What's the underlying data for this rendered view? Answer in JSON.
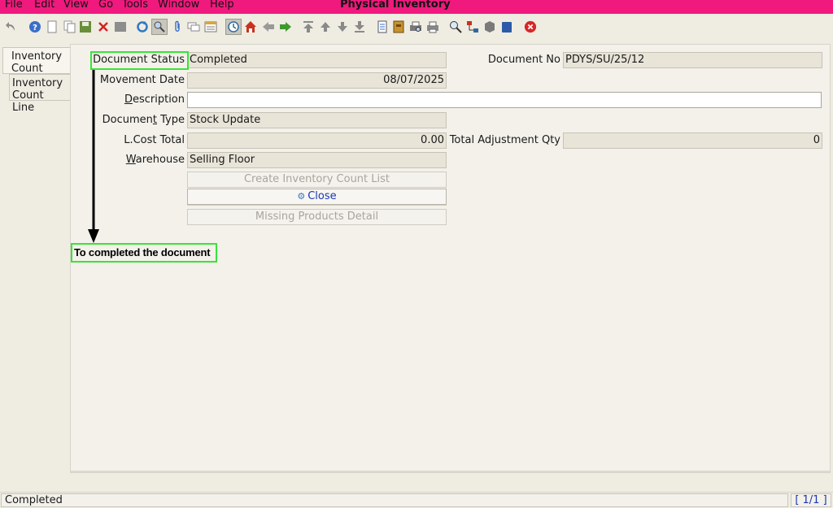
{
  "menu": {
    "file": "File",
    "edit": "Edit",
    "view": "View",
    "go": "Go",
    "tools": "Tools",
    "window": "Window",
    "help": "Help"
  },
  "window_title": "Physical Inventory",
  "toolbar_icons": [
    "undo-icon",
    "help-icon",
    "new-icon",
    "copy-icon",
    "save-icon",
    "delete-icon",
    "delete-selection-icon",
    "refresh-icon",
    "find-icon",
    "attachment-icon",
    "chat-icon",
    "grid-toggle-icon",
    "history-icon",
    "home-icon",
    "back-icon",
    "forward-icon",
    "first-record-icon",
    "previous-record-icon",
    "next-record-icon",
    "last-record-icon",
    "report-icon",
    "archive-icon",
    "print-preview-icon",
    "print-icon",
    "zoom-across-icon",
    "workflow-icon",
    "product-info-icon",
    "end-window-icon",
    "exit-icon"
  ],
  "tabs": {
    "inventory_count": "Inventory Count",
    "inventory_count_line": "Inventory Count Line"
  },
  "form": {
    "document_status": {
      "label": "Document Status",
      "value": "Completed"
    },
    "document_no": {
      "label": "Document No",
      "value": "PDYS/SU/25/12"
    },
    "movement_date": {
      "label": "Movement Date",
      "value": "08/07/2025"
    },
    "description": {
      "label_u": "D",
      "label_rest": "escription",
      "value": ""
    },
    "document_type": {
      "label_pre": "Documen",
      "label_u": "t",
      "label_post": " Type",
      "value": "Stock Update"
    },
    "lcost_total": {
      "label": "L.Cost Total",
      "value": "0.00"
    },
    "total_adjustment_qty": {
      "label": "Total Adjustment Qty",
      "value": "0"
    },
    "warehouse": {
      "label_u": "W",
      "label_rest": "arehouse",
      "value": "Selling Floor"
    }
  },
  "buttons": {
    "create_inventory_count_list": "Create Inventory Count List",
    "close": "Close",
    "missing_products_detail": "Missing Products Detail"
  },
  "annotation": {
    "text": "To completed the document",
    "color": "#39e339"
  },
  "status": {
    "message": "Completed",
    "record_count": "[ 1/1 ]"
  },
  "colors": {
    "title_bar": "#f0197d",
    "window_bg": "#efece2",
    "readonly_field": "#e8e4d8",
    "link_blue": "#1a36b5"
  }
}
